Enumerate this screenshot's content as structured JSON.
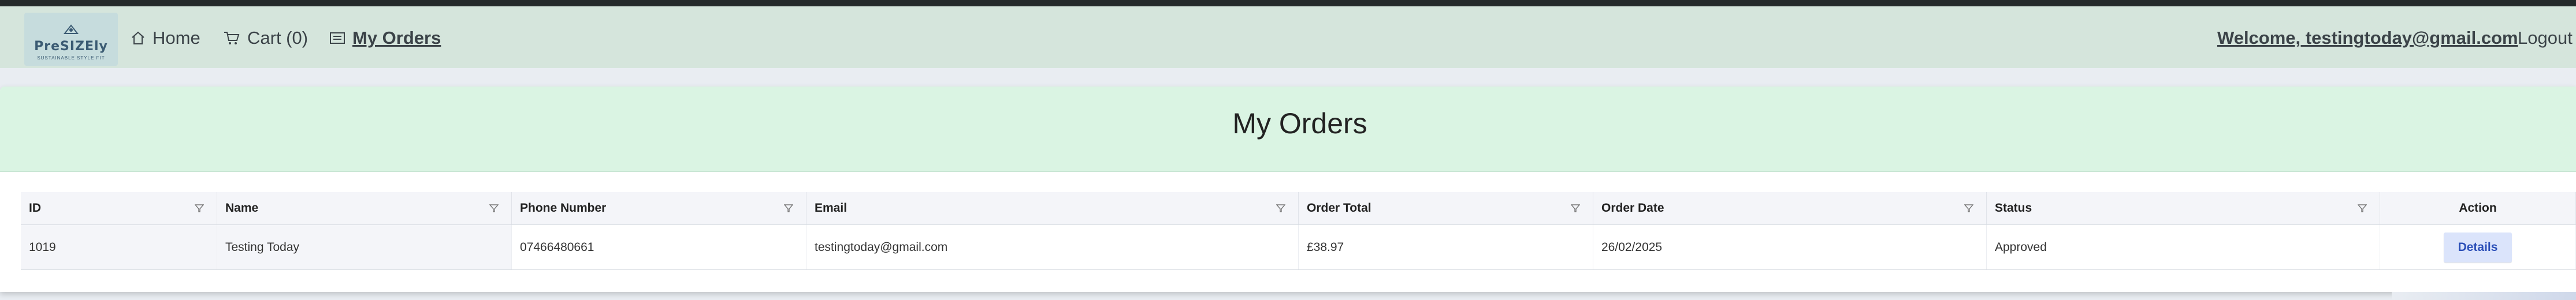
{
  "navbar": {
    "logo": {
      "brand": "PreSIZEly",
      "tagline": "SUSTAINABLE STYLE FIT"
    },
    "items": [
      {
        "label": "Home",
        "icon": "home-icon"
      },
      {
        "label": "Cart (0)",
        "icon": "cart-icon"
      },
      {
        "label": "My Orders",
        "icon": "orders-icon",
        "active": true
      }
    ],
    "welcome": "Welcome, testingtoday@gmail.com",
    "logout": "Logout"
  },
  "page": {
    "title": "My Orders"
  },
  "table": {
    "columns": [
      "ID",
      "Name",
      "Phone Number",
      "Email",
      "Order Total",
      "Order Date",
      "Status",
      "Action"
    ],
    "rows": [
      {
        "id": "1019",
        "name": "Testing Today",
        "phone": "07466480661",
        "email": "testingtoday@gmail.com",
        "total": "£38.97",
        "date": "26/02/2025",
        "status": "Approved",
        "action": "Details"
      }
    ]
  },
  "colors": {
    "navbar_bg": "#d5e5dc",
    "header_bg": "#daf4e3",
    "details_bg": "#dbe4fb",
    "details_text": "#2b4fb8"
  }
}
